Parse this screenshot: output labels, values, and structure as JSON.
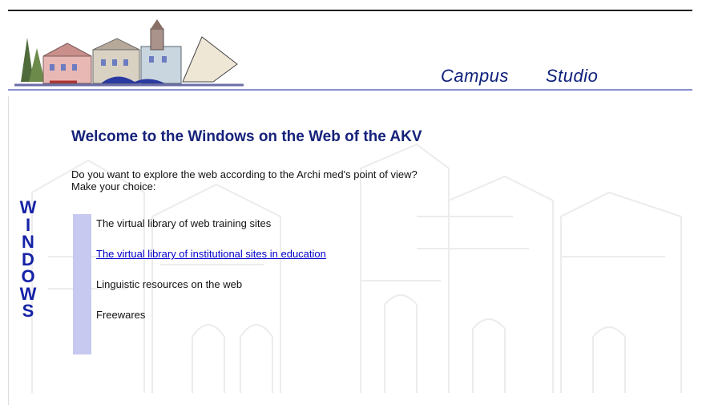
{
  "header": {
    "nav": [
      {
        "label": "Campus"
      },
      {
        "label": "Studio"
      }
    ]
  },
  "main": {
    "welcome_title": "Welcome to the Windows on the Web of the AKV",
    "intro_line1": "Do you want to explore the web according to the Archi med's point of view?",
    "intro_line2": "Make your choice:",
    "vertical_word": [
      "W",
      "I",
      "N",
      "D",
      "O",
      "W",
      "S"
    ],
    "choices": [
      {
        "label": "The virtual library of web training sites"
      },
      {
        "label": "The virtual library of institutional sites in education"
      },
      {
        "label": "Linguistic resources on the web"
      },
      {
        "label": "Freewares"
      }
    ]
  },
  "colors": {
    "title_blue": "#16227a",
    "accent_lavender": "#c7c9f0",
    "link_blue": "#0000cc"
  }
}
